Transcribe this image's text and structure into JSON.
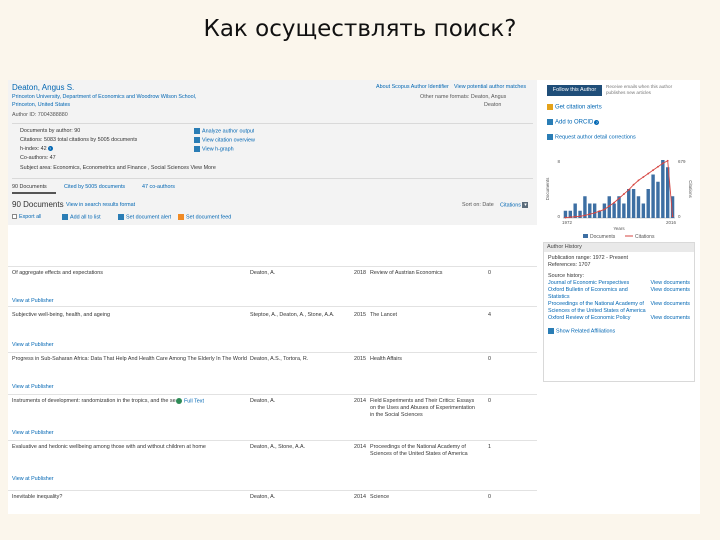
{
  "slide": {
    "title": "Как осуществлять поиск?"
  },
  "profile": {
    "name": "Deaton, Angus S.",
    "affiliation_line1": "Princeton University, Department of Economics and Woodrow Wilson School,",
    "affiliation_line2": "Princeton, United States",
    "author_id": "Author ID: 7004388880",
    "about_link": "About Scopus Author Identifier",
    "view_potential": "View potential author matches",
    "other_name": "Other name formats: Deaton, Angus",
    "other_name2": "Deaton",
    "documents_by_author": "Documents by author: 90",
    "total_citations": "Citations: 5083 total citations by 5005 documents",
    "h_index": "h-index: 42",
    "co_authors": "Co-authors: 47",
    "subject_area": "Subject area: Economics, Econometrics and Finance , Social Sciences   View More",
    "analyze_link": "Analyze author output",
    "citation_overview": "View citation overview",
    "view_hindex": "View h-graph"
  },
  "tabs": [
    {
      "label": "90 Documents"
    },
    {
      "label": "Cited by 5005 documents"
    },
    {
      "label": "47 co-authors"
    }
  ],
  "results_bar": {
    "count": "90 Documents",
    "view_link": "View in search results format",
    "sort_label": "Sort on: Date",
    "sort_value": "Citations"
  },
  "actions": {
    "export": "Export all",
    "add_list": "Add all to list",
    "set_alert": "Set document alert",
    "set_feed": "Set document feed"
  },
  "documents": [
    {
      "title": "Of aggregate effects and expectations",
      "authors": "Deaton, A.",
      "year": "2018",
      "source": "Review of Austrian Economics",
      "cited": "0",
      "links": "View at Publisher"
    },
    {
      "title": "Subjective well-being, health, and ageing",
      "authors": "Steptoe, A., Deaton, A., Stone, A.A.",
      "year": "2015",
      "source": "The Lancet",
      "cited": "4",
      "links": "View at Publisher"
    },
    {
      "title": "Progress in Sub-Saharan Africa: Data That Help And Health Care Among The Elderly In The World",
      "authors": "Deaton, A.S., Tortora, R.",
      "year": "2015",
      "source": "Health Affairs",
      "cited": "0",
      "links": "View at Publisher"
    },
    {
      "title": "Instruments of development: randomization in the tropics, and the search for the elusive keys to economic development",
      "badge": "Full Text",
      "authors": "Deaton, A.",
      "year": "2014",
      "source": "Field Experiments and Their Critics: Essays on the Uses and Abuses of Experimentation in the Social Sciences",
      "cited": "0",
      "links": "View at Publisher"
    },
    {
      "title": "Evaluative and hedonic wellbeing among those with and without children at home",
      "authors": "Deaton, A., Stone, A.A.",
      "year": "2014",
      "source": "Proceedings of the National Academy of Sciences of the United States of America",
      "cited": "1",
      "links": "View at Publisher"
    },
    {
      "title": "Inevitable inequality?",
      "authors": "Deaton, A.",
      "year": "2014",
      "source": "Science",
      "cited": "0",
      "links": ""
    }
  ],
  "sidebar": {
    "follow_button": "Follow this Author",
    "follow_note": "Receive emails when this author publishes new articles",
    "get_citation_alerts": "Get citation alerts",
    "add_orcid": "Add to ORCID",
    "request_correction": "Request author detail corrections",
    "history_title": "Author History",
    "pub_range": "Publication range: 1972 - Present",
    "references": "References: 1707",
    "source_history": "Source history:",
    "sources": [
      {
        "name": "Journal of Economic Perspectives",
        "link": "View documents"
      },
      {
        "name": "Oxford Bulletin of Economics and Statistics",
        "link": "View documents"
      },
      {
        "name": "Proceedings of the National Academy of Sciences of the United States of America",
        "link": "View documents"
      },
      {
        "name": "Oxford Review of Economic Policy",
        "link": "View documents"
      }
    ],
    "show_related": "Show Related Affiliations"
  },
  "chart_data": {
    "type": "bar",
    "title": "",
    "xlabel": "Years",
    "ylabel": "Documents",
    "y2label": "Citations",
    "categories": [
      "1972",
      "1974",
      "1976",
      "1978",
      "1980",
      "1982",
      "1984",
      "1986",
      "1988",
      "1990",
      "1992",
      "1994",
      "1996",
      "1998",
      "2000",
      "2002",
      "2004",
      "2006",
      "2008",
      "2010",
      "2012",
      "2014",
      "2016"
    ],
    "series": [
      {
        "name": "Documents",
        "type": "bar",
        "color": "#3d6fa3",
        "values": [
          1,
          1,
          2,
          1,
          3,
          2,
          2,
          1,
          2,
          3,
          2,
          3,
          2,
          4,
          4,
          3,
          2,
          4,
          6,
          5,
          8,
          7,
          3
        ]
      },
      {
        "name": "Citations",
        "type": "line",
        "color": "#d64541",
        "values": [
          5,
          10,
          15,
          20,
          30,
          45,
          60,
          80,
          100,
          140,
          180,
          230,
          280,
          330,
          390,
          440,
          480,
          520,
          560,
          600,
          640,
          670,
          20
        ]
      }
    ],
    "ylim": [
      0,
      8
    ],
    "y2lim": [
      0,
      679
    ],
    "y_ticks": [
      "8",
      "0"
    ],
    "y2_ticks": [
      "679",
      "0"
    ],
    "x_ticks": [
      "1972",
      "2016"
    ],
    "legend": "bottom"
  }
}
